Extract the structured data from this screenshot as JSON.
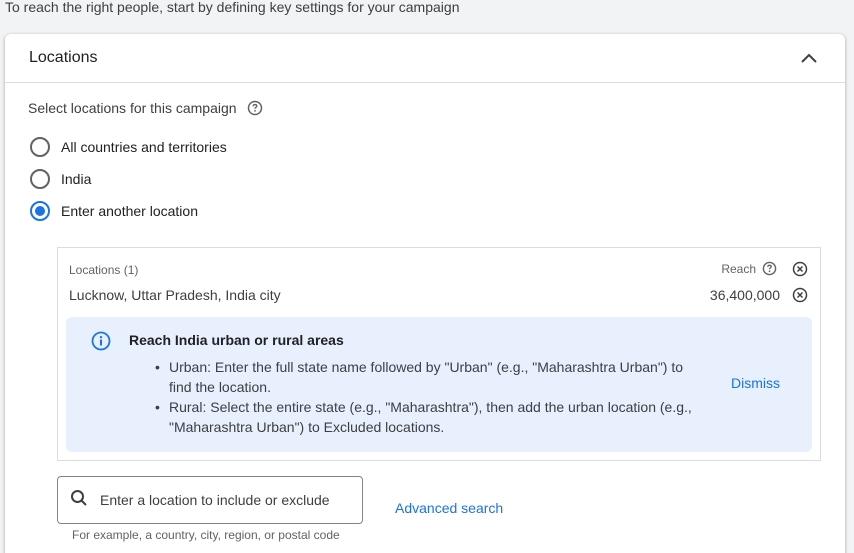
{
  "intro_text": "To reach the right people, start by defining key settings for your campaign",
  "section": {
    "title": "Locations",
    "select_label": "Select locations for this campaign"
  },
  "radio_options": [
    {
      "label": "All countries and territories",
      "checked": false
    },
    {
      "label": "India",
      "checked": false
    },
    {
      "label": "Enter another location",
      "checked": true
    }
  ],
  "locations": {
    "count_label": "Locations (1)",
    "reach_label": "Reach",
    "items": [
      {
        "name": "Lucknow, Uttar Pradesh, India city",
        "reach": "36,400,000"
      }
    ]
  },
  "info": {
    "title": "Reach India urban or rural areas",
    "bullets": [
      "Urban: Enter the full state name followed by \"Urban\" (e.g., \"Maharashtra Urban\") to find the location.",
      "Rural: Select the entire state (e.g., \"Maharashtra\"), then add the urban location (e.g., \"Maharashtra Urban\") to Excluded locations."
    ],
    "dismiss_label": "Dismiss"
  },
  "search": {
    "placeholder": "Enter a location to include or exclude",
    "hint": "For example, a country, city, region, or postal code",
    "advanced_label": "Advanced search"
  },
  "colors": {
    "accent": "#1a73e8",
    "info_bg": "#e8f0fe"
  }
}
